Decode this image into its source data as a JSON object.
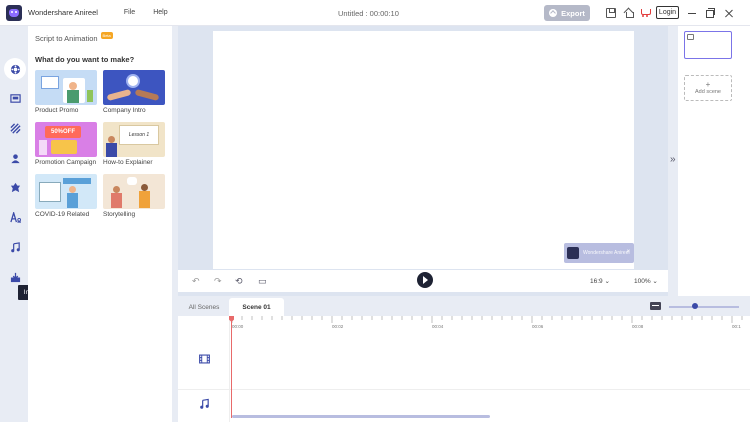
{
  "titlebar": {
    "app_name": "Wondershare Anireel",
    "menu": [
      "File",
      "Help"
    ],
    "doc_title": "Untitled : 00:00:10",
    "export_label": "Export",
    "login_label": "Login"
  },
  "leftnav": {
    "tooltip": "Import"
  },
  "panel": {
    "header": "Script to Animation",
    "beta": "Beta",
    "question": "What do you want to make?",
    "templates": [
      {
        "label": "Product Promo"
      },
      {
        "label": "Company Intro"
      },
      {
        "label": "Promotion Campaign"
      },
      {
        "label": "How-to Explainer"
      },
      {
        "label": "COVID-19 Related"
      },
      {
        "label": "Storytelling"
      }
    ],
    "promo_thumb_text": "50%OFF",
    "howto_thumb_text": "Lesson 1"
  },
  "stage": {
    "watermark_text": "Wondershare Anireel"
  },
  "controls": {
    "aspect_ratio": "16:9",
    "zoom": "100%"
  },
  "scenes": {
    "add_label": "Add scene"
  },
  "timeline": {
    "tabs": [
      "All Scenes",
      "Scene 01"
    ],
    "ticks": [
      "00:00",
      "00:02",
      "00:04",
      "00:06",
      "00:08",
      "00:1"
    ]
  },
  "colors": {
    "accent": "#7b74e8",
    "dark": "#1e2233",
    "playhead": "#e86a6a"
  }
}
